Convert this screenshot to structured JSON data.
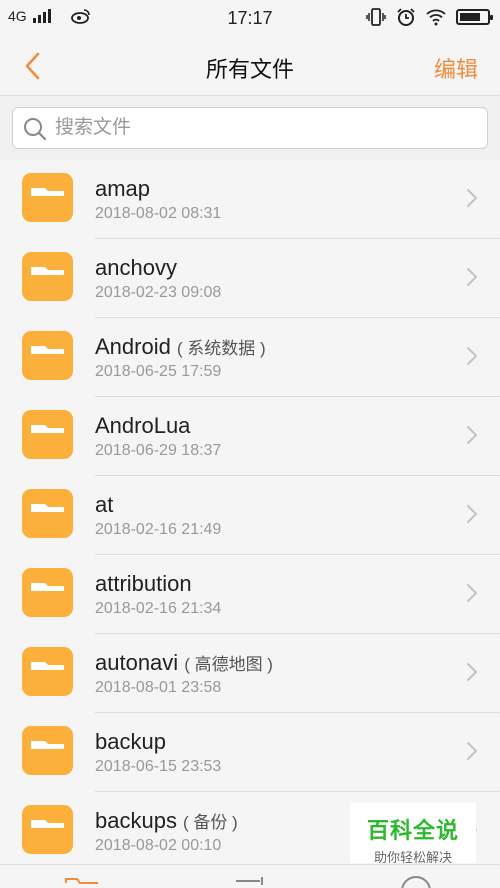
{
  "status_bar": {
    "network": "4G",
    "time": "17:17",
    "icons": [
      "signal-icon",
      "weibo-icon",
      "vibrate-icon",
      "alarm-icon",
      "wifi-icon",
      "battery-icon"
    ]
  },
  "header": {
    "title": "所有文件",
    "edit_label": "编辑",
    "back_icon": "chevron-left-icon"
  },
  "search": {
    "placeholder": "搜索文件"
  },
  "colors": {
    "accent": "#f08c3c",
    "folder": "#fbb03b"
  },
  "files": [
    {
      "name": "amap",
      "tag": "",
      "date": "2018-08-02 08:31"
    },
    {
      "name": "anchovy",
      "tag": "",
      "date": "2018-02-23 09:08"
    },
    {
      "name": "Android",
      "tag": "( 系统数据 )",
      "date": "2018-06-25 17:59"
    },
    {
      "name": "AndroLua",
      "tag": "",
      "date": "2018-06-29 18:37"
    },
    {
      "name": "at",
      "tag": "",
      "date": "2018-02-16 21:49"
    },
    {
      "name": "attribution",
      "tag": "",
      "date": "2018-02-16 21:34"
    },
    {
      "name": "autonavi",
      "tag": "( 高德地图 )",
      "date": "2018-08-01 23:58"
    },
    {
      "name": "backup",
      "tag": "",
      "date": "2018-06-15 23:53"
    },
    {
      "name": "backups",
      "tag": "( 备份 )",
      "date": "2018-08-02 00:10"
    }
  ],
  "watermark": {
    "title": "百科全说",
    "subtitle": "助你轻松解决"
  }
}
